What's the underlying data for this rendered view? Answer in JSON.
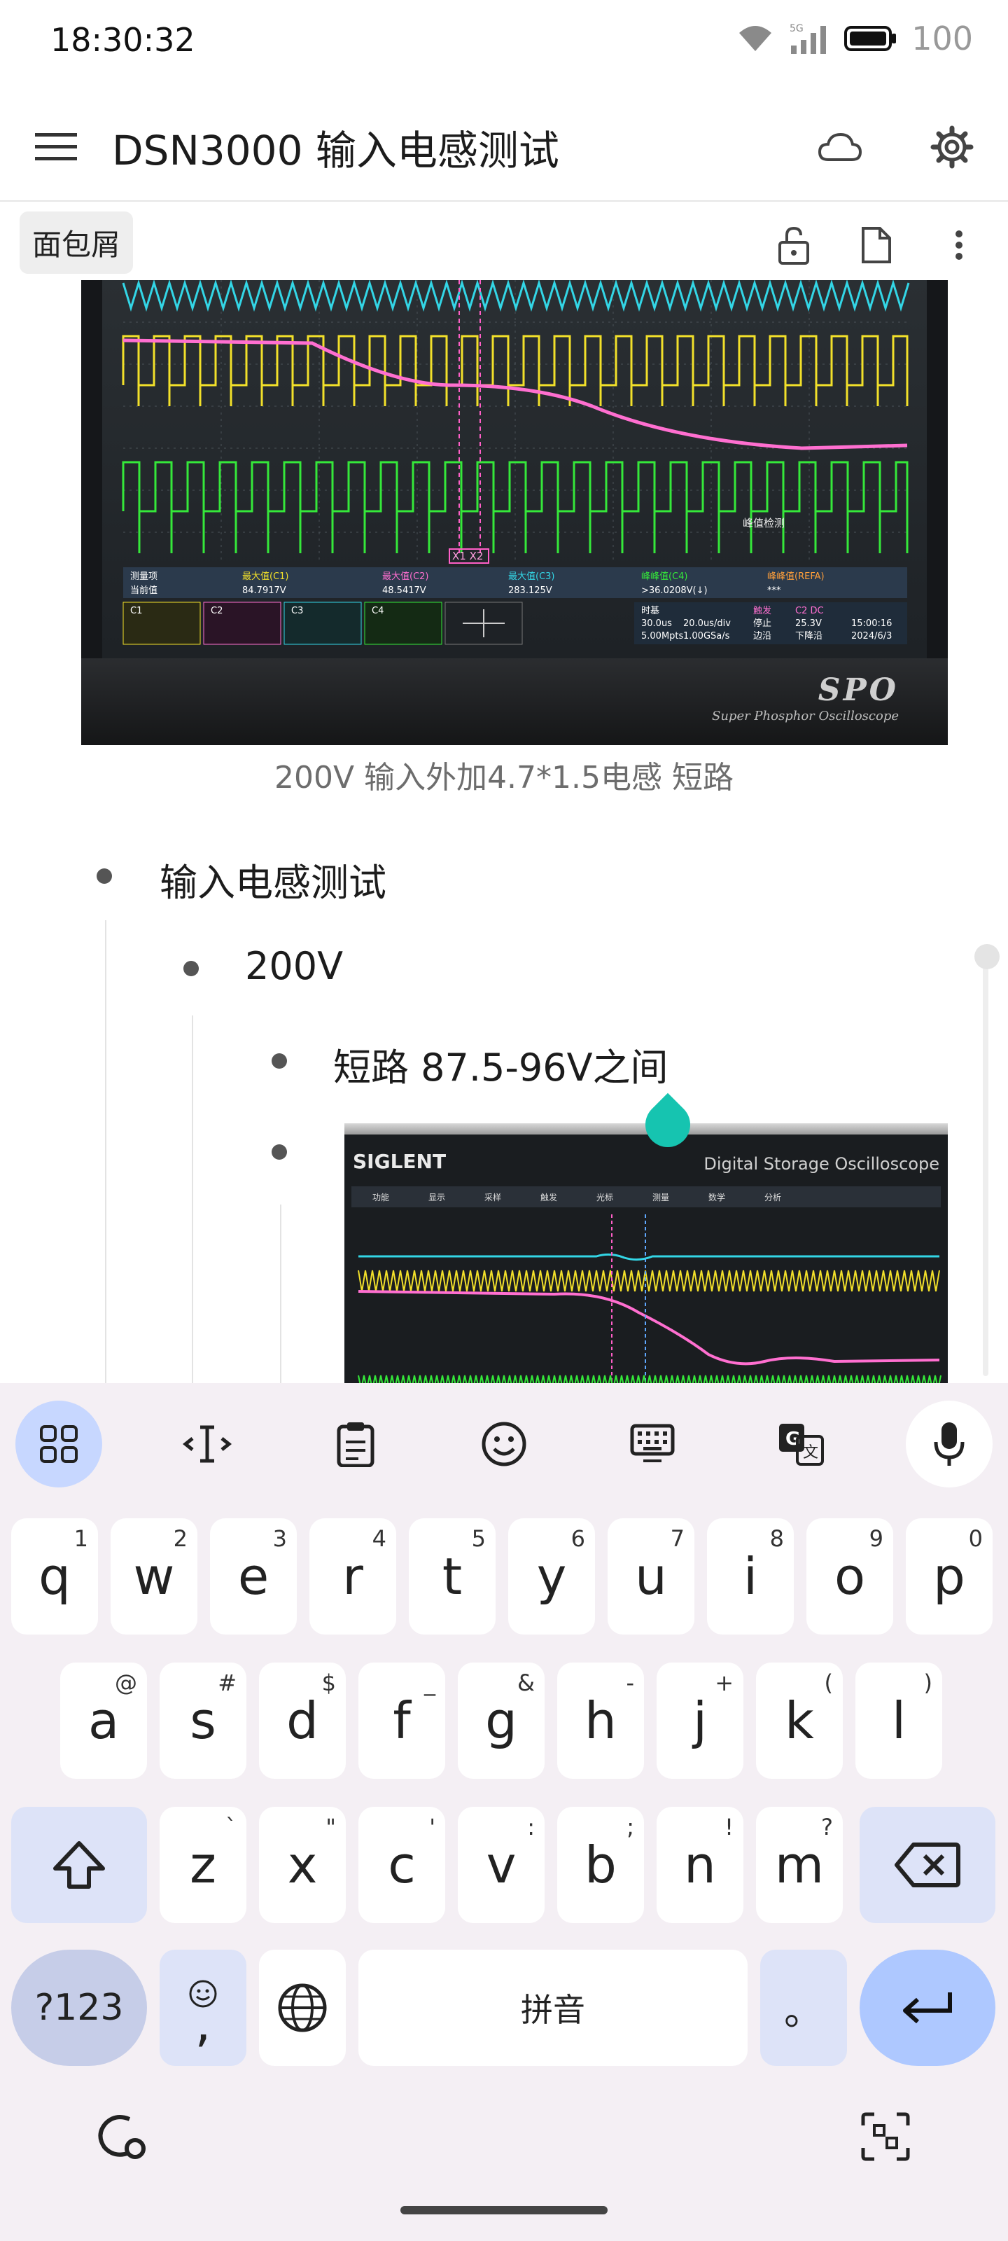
{
  "status_bar": {
    "time": "18:30:32",
    "battery": "100"
  },
  "app_bar": {
    "title": "DSN3000 输入电感测试"
  },
  "toolbar": {
    "breadcrumb": "面包屑"
  },
  "content": {
    "image1": {
      "caption": "200V 输入外加4.7*1.5电感 短路",
      "brand": "SPO",
      "brand_sub": "Super Phosphor Oscilloscope",
      "annotation": "峰值检测",
      "cursor_label": "X1 X2",
      "measure": {
        "headers": [
          "测量项",
          "最大值(C1)",
          "最大值(C2)",
          "最大值(C3)",
          "峰峰值(C4)",
          "峰峰值(REFA)"
        ],
        "current_label": "当前值",
        "values": [
          "84.7917V",
          "48.5417V",
          "283.125V",
          ">36.0208V(↓)",
          "***"
        ]
      },
      "channels": [
        "C1",
        "C2",
        "C3",
        "C4"
      ],
      "time_settings": [
        "时基",
        "30.0us",
        "20.0us/div",
        "5.00Mpts",
        "1.00GSa/s"
      ],
      "trigger": [
        "触发",
        "停止",
        "边沿",
        "C2 DC",
        "25.3V",
        "下降沿"
      ],
      "date": "15:00:16",
      "date2": "2024/6/3"
    },
    "list": [
      {
        "level": 1,
        "text": "输入电感测试"
      },
      {
        "level": 2,
        "text": "200V"
      },
      {
        "level": 3,
        "text": "短路 87.5-96V之间"
      },
      {
        "level": 3,
        "text": ""
      }
    ],
    "image2": {
      "brand": "SIGLENT",
      "label": "Digital Storage Oscilloscope",
      "menu": [
        "功能",
        "显示",
        "采样",
        "触发",
        "光标",
        "测量",
        "数学",
        "分析"
      ]
    }
  },
  "keyboard": {
    "row1": [
      {
        "key": "q",
        "hint": "1"
      },
      {
        "key": "w",
        "hint": "2"
      },
      {
        "key": "e",
        "hint": "3"
      },
      {
        "key": "r",
        "hint": "4"
      },
      {
        "key": "t",
        "hint": "5"
      },
      {
        "key": "y",
        "hint": "6"
      },
      {
        "key": "u",
        "hint": "7"
      },
      {
        "key": "i",
        "hint": "8"
      },
      {
        "key": "o",
        "hint": "9"
      },
      {
        "key": "p",
        "hint": "0"
      }
    ],
    "row2": [
      {
        "key": "a",
        "hint": "@"
      },
      {
        "key": "s",
        "hint": "#"
      },
      {
        "key": "d",
        "hint": "$"
      },
      {
        "key": "f",
        "hint": "_"
      },
      {
        "key": "g",
        "hint": "&"
      },
      {
        "key": "h",
        "hint": "-"
      },
      {
        "key": "j",
        "hint": "+"
      },
      {
        "key": "k",
        "hint": "("
      },
      {
        "key": "l",
        "hint": ")"
      }
    ],
    "row3": [
      {
        "key": "z",
        "hint": "`"
      },
      {
        "key": "x",
        "hint": "\""
      },
      {
        "key": "c",
        "hint": "'"
      },
      {
        "key": "v",
        "hint": ":"
      },
      {
        "key": "b",
        "hint": ";"
      },
      {
        "key": "n",
        "hint": "!"
      },
      {
        "key": "m",
        "hint": "?"
      }
    ],
    "symbols": "?123",
    "comma": ",",
    "space": "拼音",
    "period": "。"
  }
}
